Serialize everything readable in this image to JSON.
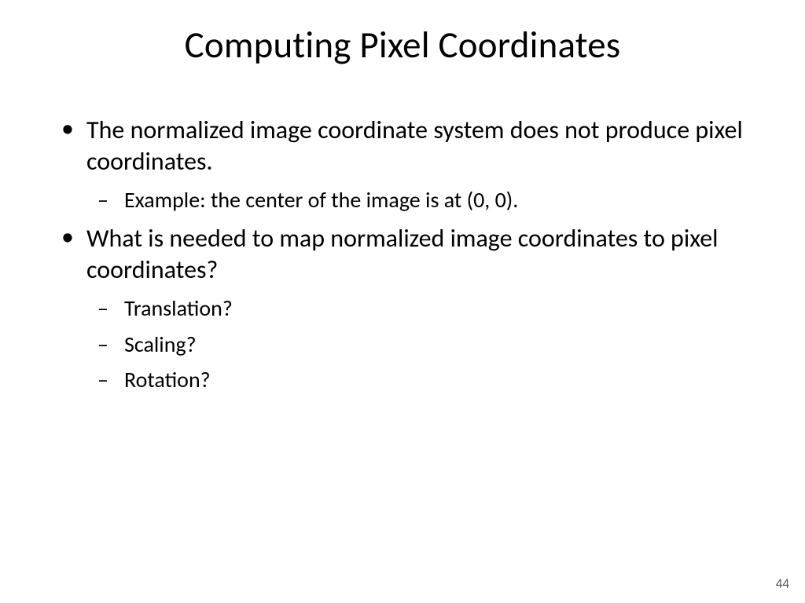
{
  "title": "Computing Pixel Coordinates",
  "bullets": [
    {
      "text": "The normalized image coordinate system does not produce pixel coordinates.",
      "sub": [
        "Example: the center of the image is at (0, 0)."
      ]
    },
    {
      "text": "What is needed to map normalized image coordinates to pixel coordinates?",
      "sub": [
        "Translation?",
        "Scaling?",
        "Rotation?"
      ]
    }
  ],
  "pageNumber": "44"
}
